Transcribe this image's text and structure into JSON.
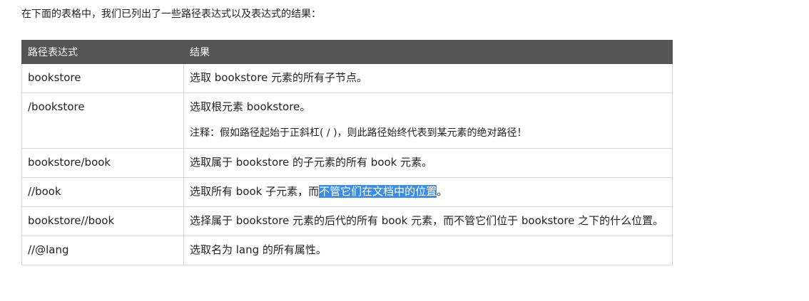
{
  "intro": "在下面的表格中，我们已列出了一些路径表达式以及表达式的结果：",
  "table": {
    "headers": [
      "路径表达式",
      "结果"
    ],
    "rows": [
      {
        "expr": "bookstore",
        "result": "选取 bookstore 元素的所有子节点。"
      },
      {
        "expr": "/bookstore",
        "result": "选取根元素 bookstore。",
        "note": "注释：假如路径起始于正斜杠( / )，则此路径始终代表到某元素的绝对路径！"
      },
      {
        "expr": "bookstore/book",
        "result": "选取属于 bookstore 的子元素的所有 book 元素。"
      },
      {
        "expr": "//book",
        "result_pre": "选取所有 book 子元素，而",
        "result_highlight": "不管它们在文档中的位置",
        "result_post": "。"
      },
      {
        "expr": "bookstore//book",
        "result": "选择属于 bookstore 元素的后代的所有 book 元素，而不管它们位于 bookstore 之下的什么位置。"
      },
      {
        "expr": "//@lang",
        "result": "选取名为 lang 的所有属性。"
      }
    ]
  },
  "colors": {
    "header_bg": "#555555",
    "header_text": "#ffffff",
    "border": "#d6d6d6",
    "selection": "#3a8ee6"
  }
}
